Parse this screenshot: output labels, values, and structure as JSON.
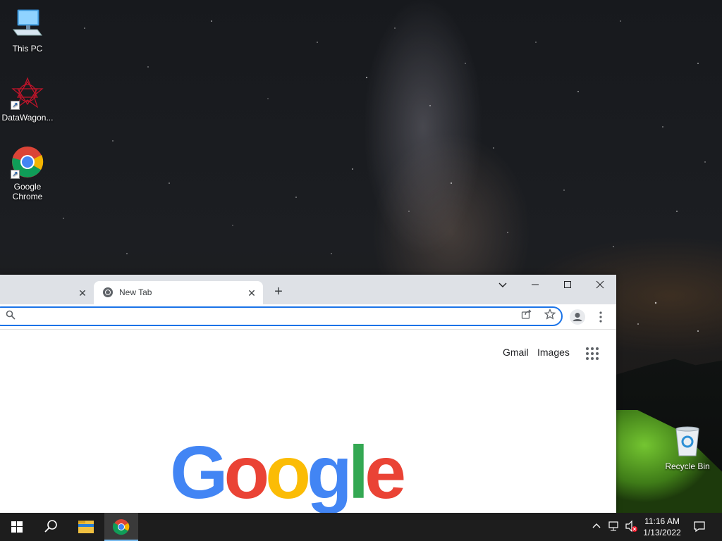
{
  "desktop": {
    "icons": [
      {
        "label": "This PC"
      },
      {
        "label": "DataWagon..."
      },
      {
        "label": "Google Chrome"
      },
      {
        "label": "Recycle Bin"
      }
    ]
  },
  "browser": {
    "tabs": [
      {
        "title": "",
        "active": false
      },
      {
        "title": "New Tab",
        "active": true
      }
    ],
    "new_tab_symbol": "+",
    "window_controls": {
      "menu": "⌄",
      "minimize": "—",
      "maximize": "□",
      "close": "✕"
    },
    "omnibox": {
      "value": "",
      "placeholder": ""
    },
    "toolbar_icons": [
      "search-icon",
      "share-icon",
      "star-icon",
      "profile-icon",
      "menu-icon"
    ],
    "newtab_page": {
      "links": [
        "Gmail",
        "Images"
      ],
      "logo_letters": [
        {
          "ch": "G",
          "color": "#4285f4"
        },
        {
          "ch": "o",
          "color": "#ea4335"
        },
        {
          "ch": "o",
          "color": "#fbbc05"
        },
        {
          "ch": "g",
          "color": "#4285f4"
        },
        {
          "ch": "l",
          "color": "#34a853"
        },
        {
          "ch": "e",
          "color": "#ea4335"
        }
      ]
    }
  },
  "taskbar": {
    "pinned": [
      "start-icon",
      "search-icon",
      "file-explorer-icon",
      "chrome-icon"
    ],
    "active_app": "chrome-icon",
    "clock": {
      "time": "11:16 AM",
      "date": "1/13/2022"
    }
  }
}
